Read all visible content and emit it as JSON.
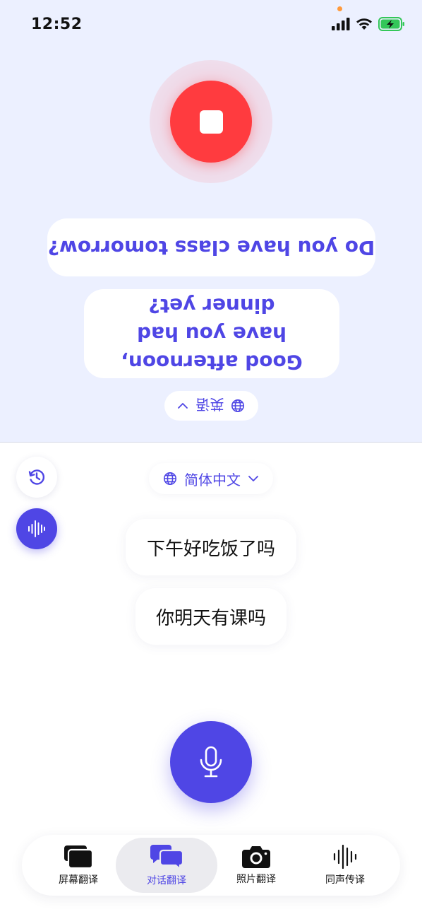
{
  "status_bar": {
    "time": "12:52"
  },
  "partner_panel": {
    "messages": [
      {
        "text": "Do you have class tomorrow?"
      },
      {
        "text": "Good afternoon, have you had dinner yet?"
      }
    ],
    "language": {
      "label": "英语",
      "icon": "globe-icon"
    },
    "recording": true
  },
  "my_panel": {
    "language": {
      "label": "简体中文",
      "icon": "globe-icon"
    },
    "messages": [
      {
        "text": "下午好吃饭了吗"
      },
      {
        "text": "你明天有课吗"
      }
    ]
  },
  "tab_bar": {
    "tabs": [
      {
        "label": "屏幕翻译",
        "icon": "screens-icon",
        "active": false
      },
      {
        "label": "对话翻译",
        "icon": "chat-bubbles-icon",
        "active": true
      },
      {
        "label": "照片翻译",
        "icon": "camera-icon",
        "active": false
      },
      {
        "label": "同声传译",
        "icon": "soundwave-icon",
        "active": false
      }
    ]
  },
  "colors": {
    "accent": "#4f46e5",
    "record_red": "#ff3b3f",
    "panel_bg": "#ecf0ff",
    "battery_green": "#34c759"
  }
}
